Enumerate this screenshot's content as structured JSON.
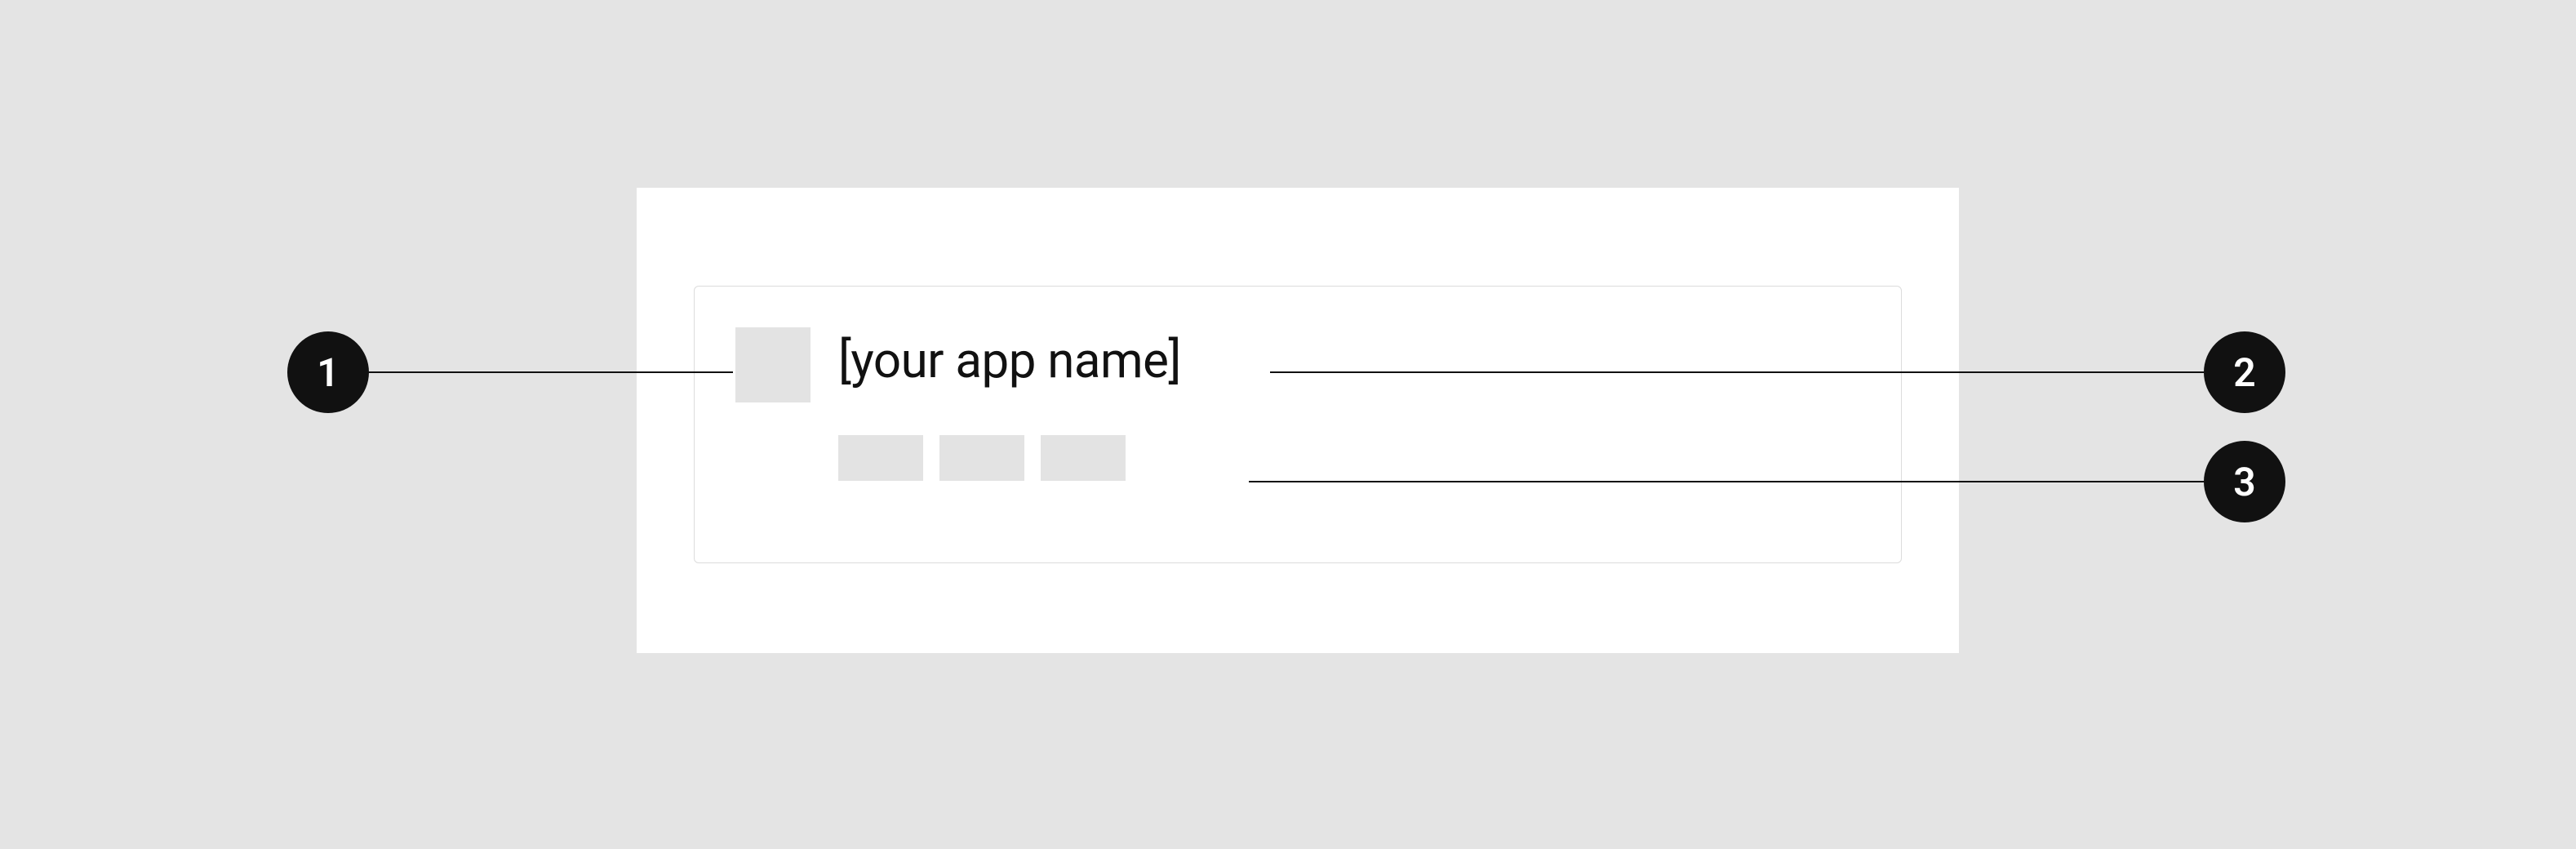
{
  "card": {
    "app_name": "[your app name]"
  },
  "annotations": {
    "a1": "1",
    "a2": "2",
    "a3": "3"
  }
}
